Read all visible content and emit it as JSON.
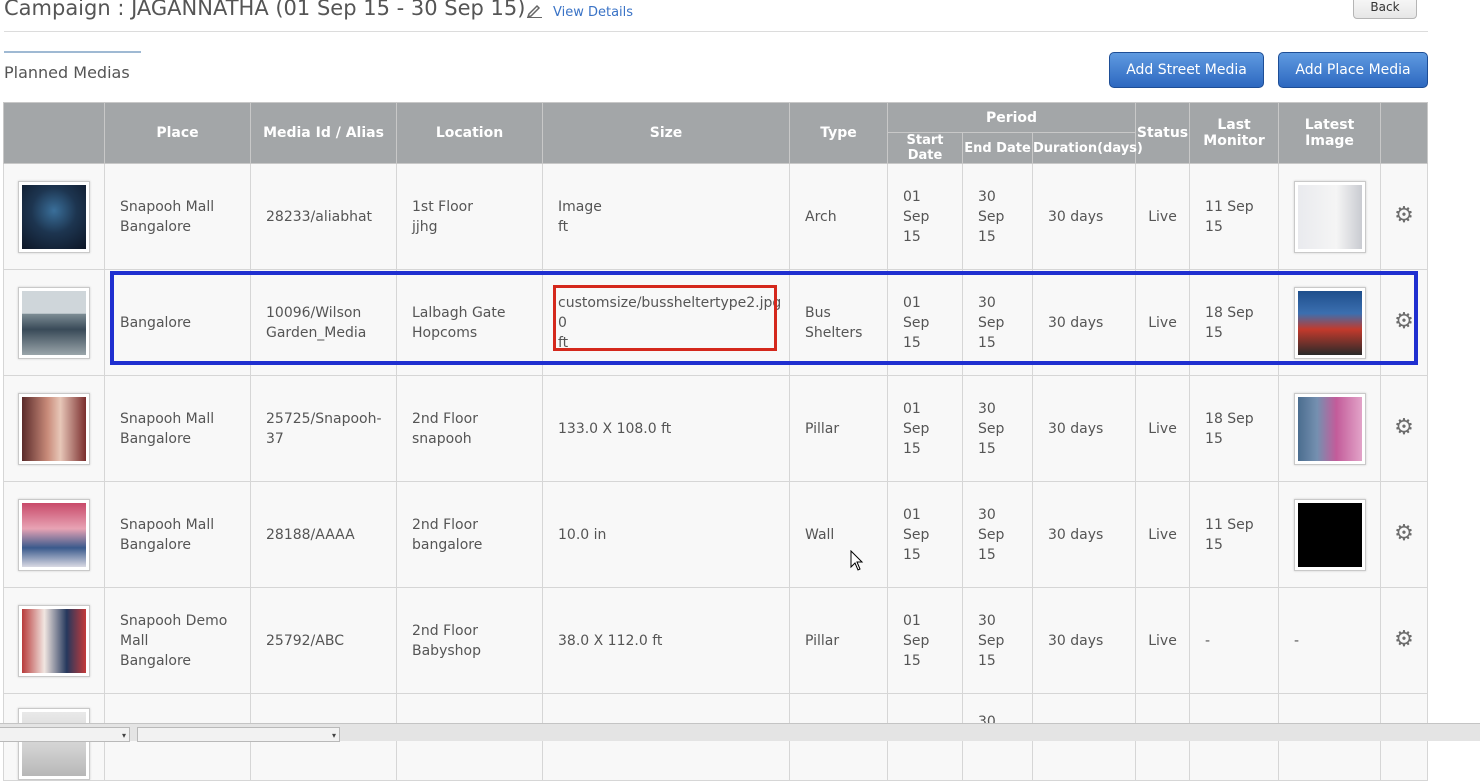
{
  "header": {
    "title": "Campaign : JAGANNATHA (01 Sep 15 - 30 Sep 15)",
    "view_details": "View Details",
    "back": "Back"
  },
  "section": {
    "title": "Planned Medias",
    "add_street": "Add Street Media",
    "add_place": "Add Place Media"
  },
  "table": {
    "headers": {
      "place": "Place",
      "media_id": "Media Id / Alias",
      "location": "Location",
      "size": "Size",
      "type": "Type",
      "period": "Period",
      "start_date": "Start Date",
      "end_date": "End Date",
      "duration": "Duration(days)",
      "status": "Status",
      "last_monitor": "Last Monitor",
      "latest_image": "Latest Image"
    },
    "rows": [
      {
        "place": [
          "Snapooh Mall",
          "Bangalore"
        ],
        "media_id": [
          "28233/aliabhat"
        ],
        "location": [
          "1st Floor",
          "jjhg"
        ],
        "size": [
          "Image",
          "ft"
        ],
        "type": [
          "Arch"
        ],
        "start": [
          "01 Sep",
          "15"
        ],
        "end": [
          "30",
          "Sep",
          "15"
        ],
        "duration": "30 days",
        "status": "Live",
        "last_monitor": [
          "11 Sep",
          "15"
        ],
        "latest_image": "image"
      },
      {
        "place": [
          "Bangalore"
        ],
        "media_id": [
          "10096/Wilson",
          "Garden_Media"
        ],
        "location": [
          "Lalbagh Gate",
          "Hopcoms"
        ],
        "size": [
          "customsize/bussheltertype2.jpg",
          "0",
          "ft"
        ],
        "type": [
          "Bus",
          "Shelters"
        ],
        "start": [
          "01 Sep",
          "15"
        ],
        "end": [
          "30",
          "Sep",
          "15"
        ],
        "duration": "30 days",
        "status": "Live",
        "last_monitor": [
          "18 Sep",
          "15"
        ],
        "latest_image": "image"
      },
      {
        "place": [
          "Snapooh Mall",
          "Bangalore"
        ],
        "media_id": [
          "25725/Snapooh-",
          "37"
        ],
        "location": [
          "2nd Floor",
          "snapooh"
        ],
        "size": [
          "133.0 X 108.0 ft"
        ],
        "type": [
          "Pillar"
        ],
        "start": [
          "01 Sep",
          "15"
        ],
        "end": [
          "30",
          "Sep",
          "15"
        ],
        "duration": "30 days",
        "status": "Live",
        "last_monitor": [
          "18 Sep",
          "15"
        ],
        "latest_image": "image"
      },
      {
        "place": [
          "Snapooh Mall",
          "Bangalore"
        ],
        "media_id": [
          "28188/AAAA"
        ],
        "location": [
          "2nd Floor",
          "bangalore"
        ],
        "size": [
          "10.0 in"
        ],
        "type": [
          "Wall"
        ],
        "start": [
          "01 Sep",
          "15"
        ],
        "end": [
          "30",
          "Sep",
          "15"
        ],
        "duration": "30 days",
        "status": "Live",
        "last_monitor": [
          "11 Sep",
          "15"
        ],
        "latest_image": "image"
      },
      {
        "place": [
          "Snapooh Demo",
          "Mall",
          "Bangalore"
        ],
        "media_id": [
          "25792/ABC"
        ],
        "location": [
          "2nd Floor",
          "Babyshop"
        ],
        "size": [
          "38.0 X 112.0 ft"
        ],
        "type": [
          "Pillar"
        ],
        "start": [
          "01 Sep",
          "15"
        ],
        "end": [
          "30",
          "Sep",
          "15"
        ],
        "duration": "30 days",
        "status": "Live",
        "last_monitor": [
          "-"
        ],
        "latest_image": "-"
      }
    ],
    "partial_row": {
      "end": "30"
    }
  },
  "icons": {
    "edit": "pencil-icon",
    "settings": "gear-icon",
    "cursor": "mouse-cursor-icon"
  },
  "colors": {
    "header_bg": "#a3a6a8",
    "button_blue": "#2d68c0",
    "highlight_row": "#1f2fd0",
    "highlight_cell": "#d4281c",
    "link": "#3a73c6"
  }
}
